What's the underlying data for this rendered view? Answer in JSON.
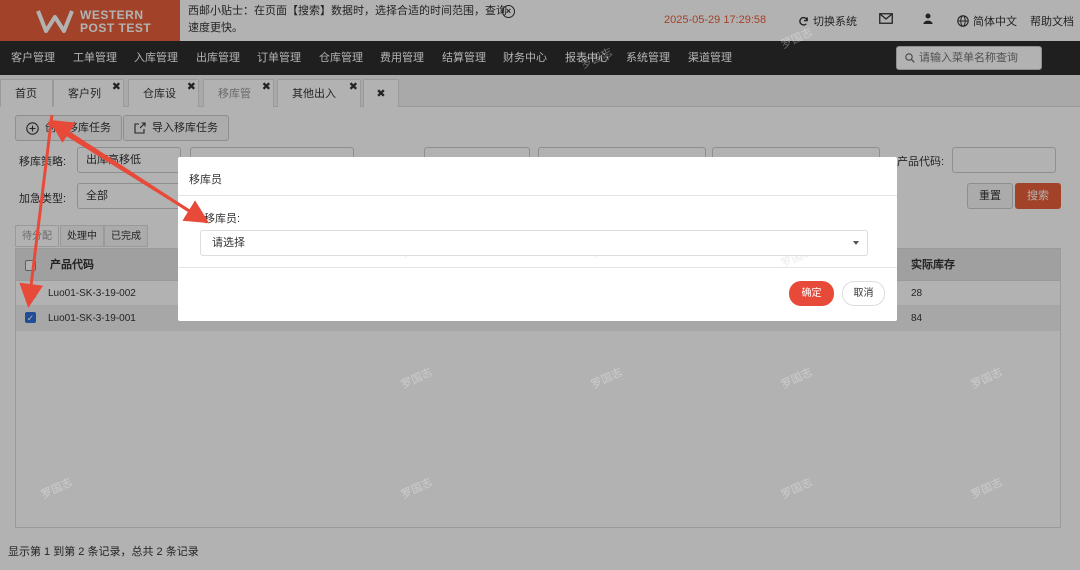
{
  "logo": {
    "line1": "WESTERN",
    "line2": "POST TEST"
  },
  "tip": {
    "text": "西邮小贴士：在页面【搜索】数据时，选择合适的时间范围，查询速度更快。"
  },
  "header": {
    "datetime": "2025-05-29 17:29:58",
    "switch_system": "切换系统",
    "language": "简体中文",
    "help": "帮助文档"
  },
  "menu": {
    "items": [
      "客户管理",
      "工单管理",
      "入库管理",
      "出库管理",
      "订单管理",
      "仓库管理",
      "费用管理",
      "结算管理",
      "财务中心",
      "报表中心",
      "系统管理",
      "渠道管理"
    ],
    "search_placeholder": "请输入菜单名称查询"
  },
  "tabs": [
    "首页",
    "客户列表",
    "仓库设置",
    "移库管理",
    "其他出入库"
  ],
  "toolbar": {
    "create_task": "创建移库任务",
    "import_task": "导入移库任务"
  },
  "filters": {
    "strategy_label": "移库策略:",
    "strategy_value": "出库高移低",
    "product_code_label": "产品代码:",
    "urgent_label": "加急类型:",
    "urgent_value": "全部",
    "reset": "重置",
    "search": "搜索"
  },
  "subtabs": [
    "待分配",
    "处理中",
    "已完成"
  ],
  "table": {
    "col_product_code": "产品代码",
    "col_actual_stock": "实际库存",
    "rows": [
      {
        "code": "Luo01-SK-3-19-002",
        "stock": "28",
        "checked": false
      },
      {
        "code": "Luo01-SK-3-19-001",
        "stock": "84",
        "checked": true
      }
    ]
  },
  "pagination": {
    "info": "显示第 1 到第 2 条记录，总共 2 条记录"
  },
  "modal": {
    "title": "移库员",
    "field_label": "移库员:",
    "select_placeholder": "请选择",
    "confirm": "确定",
    "cancel": "取消"
  },
  "watermark": "罗国志",
  "colors": {
    "brand": "#e8613c",
    "menubar": "#2d2d2d",
    "confirm": "#e84a3a",
    "arrow": "#e84a3a"
  }
}
